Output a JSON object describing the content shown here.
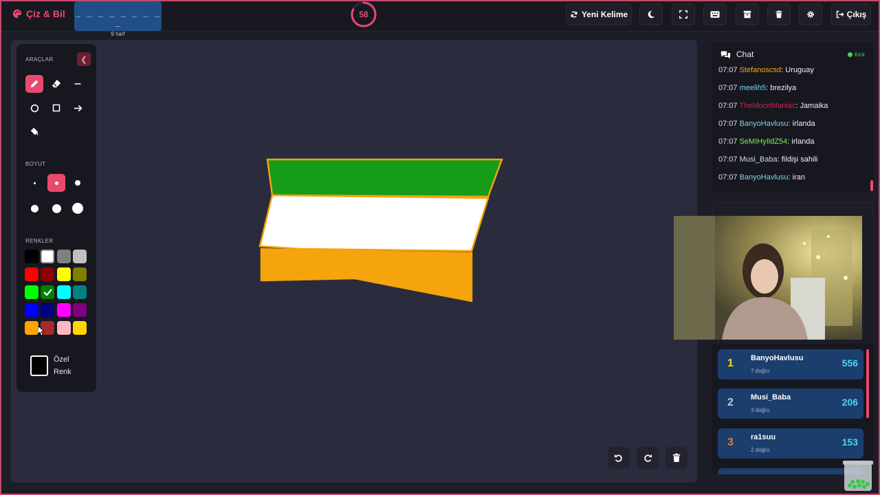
{
  "header": {
    "app_name": "Çiz & Bil",
    "word_pattern": "_ _ _ _ _ _ _ _ _",
    "word_length": "9 harf",
    "timer_value": "58",
    "timer_fraction": 0.82,
    "new_word_label": "Yeni Kelime",
    "exit_label": "Çıkış"
  },
  "tools": {
    "title": "ARAÇLAR",
    "items": [
      "pencil-icon",
      "eraser-icon",
      "line-icon",
      "circle-icon",
      "square-icon",
      "arrow-icon",
      "fill-bucket-icon"
    ],
    "active_tool": "pencil",
    "size_title": "BOYUT",
    "active_size_index": 1,
    "colors_title": "RENKLER",
    "colors": [
      "#000000",
      "#ffffff",
      "#808080",
      "#c0c0c0",
      "#ff0000",
      "#8b0000",
      "#ffff00",
      "#808000",
      "#00ff00",
      "#008000",
      "#00ffff",
      "#008080",
      "#0000ff",
      "#000080",
      "#ff00ff",
      "#800080",
      "#ffa500",
      "#a52a2a",
      "#ffb6c1",
      "#ffd700"
    ],
    "selected_color_index": 9,
    "custom_color_label": "Özel Renk"
  },
  "chat": {
    "title": "Chat",
    "platform": "Kick",
    "messages": [
      {
        "time": "07:07",
        "user": "Stefanoscsd",
        "color": "#f5a623",
        "text": ": Uruguay"
      },
      {
        "time": "07:07",
        "user": "meelih5",
        "color": "#7fd4e8",
        "text": ": brezilya"
      },
      {
        "time": "07:07",
        "user": "TheMoonManiac",
        "color": "#d0234f",
        "text": ": Jamaika"
      },
      {
        "time": "07:07",
        "user": "BanyoHavlusu",
        "color": "#7fd4e8",
        "text": ": irlanda"
      },
      {
        "time": "07:07",
        "user": "SeMIHyIldZ54",
        "color": "#7ff25c",
        "text": ": irlanda"
      },
      {
        "time": "07:07",
        "user": "Musi_Baba",
        "color": "#d8d8e0",
        "text": ": fildişi sahili"
      },
      {
        "time": "07:07",
        "user": "BanyoHavlusu",
        "color": "#7fd4e8",
        "text": ": iran"
      }
    ]
  },
  "leaderboard": [
    {
      "rank": "1",
      "name": "BanyoHavlusu",
      "correct": "7 doğru",
      "points": "556",
      "rank_color": "#ffd700"
    },
    {
      "rank": "2",
      "name": "Musi_Baba",
      "correct": "3 doğru",
      "points": "206",
      "rank_color": "#c0c8d4"
    },
    {
      "rank": "3",
      "name": "ra1suu",
      "correct": "2 doğru",
      "points": "153",
      "rank_color": "#e07a3a"
    }
  ],
  "drawing": {
    "stripes": [
      "#179c1a",
      "#ffffff",
      "#f5a40c"
    ],
    "outline": "#f5a40c"
  },
  "theme": {
    "accent": "#e84a6e",
    "canvas_bg": "#2a2b3d"
  }
}
